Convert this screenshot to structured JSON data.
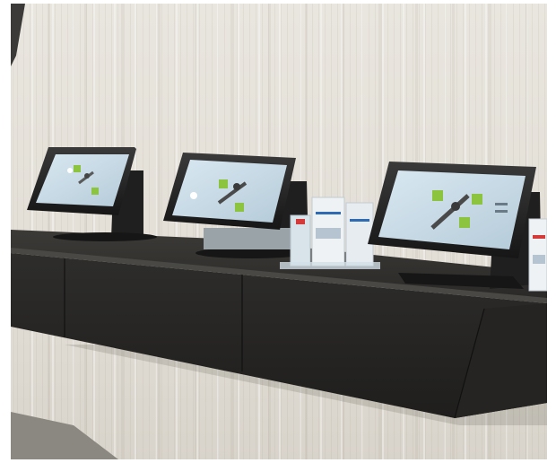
{
  "scene": {
    "subject": "kiosk-counter-with-three-touchscreen-terminals",
    "wall_color": "#e6e2da",
    "counter_color": "#2a2927",
    "screen_color": "#c9dbe6",
    "screen_accent_color": "#8cc43f"
  },
  "kiosks": [
    {
      "id": "left"
    },
    {
      "id": "middle"
    },
    {
      "id": "right"
    }
  ],
  "brochure_racks": [
    {
      "id": "center-rack"
    },
    {
      "id": "right-rack"
    }
  ]
}
